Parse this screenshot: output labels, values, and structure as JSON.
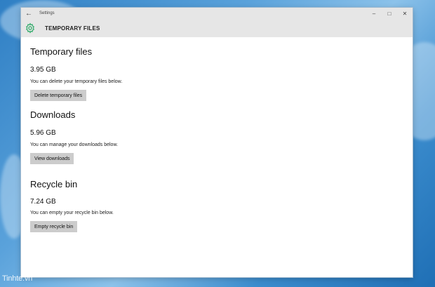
{
  "window": {
    "app_title": "Settings",
    "page_title": "TEMPORARY FILES"
  },
  "sections": [
    {
      "title": "Temporary files",
      "size": "3.95 GB",
      "description": "You can delete your temporary files below.",
      "button": "Delete temporary files"
    },
    {
      "title": "Downloads",
      "size": "5.96 GB",
      "description": "You can manage your downloads below.",
      "button": "View downloads"
    },
    {
      "title": "Recycle bin",
      "size": "7.24 GB",
      "description": "You can empty your recycle bin below.",
      "button": "Empty recycle bin"
    }
  ],
  "watermark": "Tinhte.vn",
  "colors": {
    "accent": "#2eaa68",
    "titlebar": "#e6e6e6",
    "button": "#cccccc"
  }
}
